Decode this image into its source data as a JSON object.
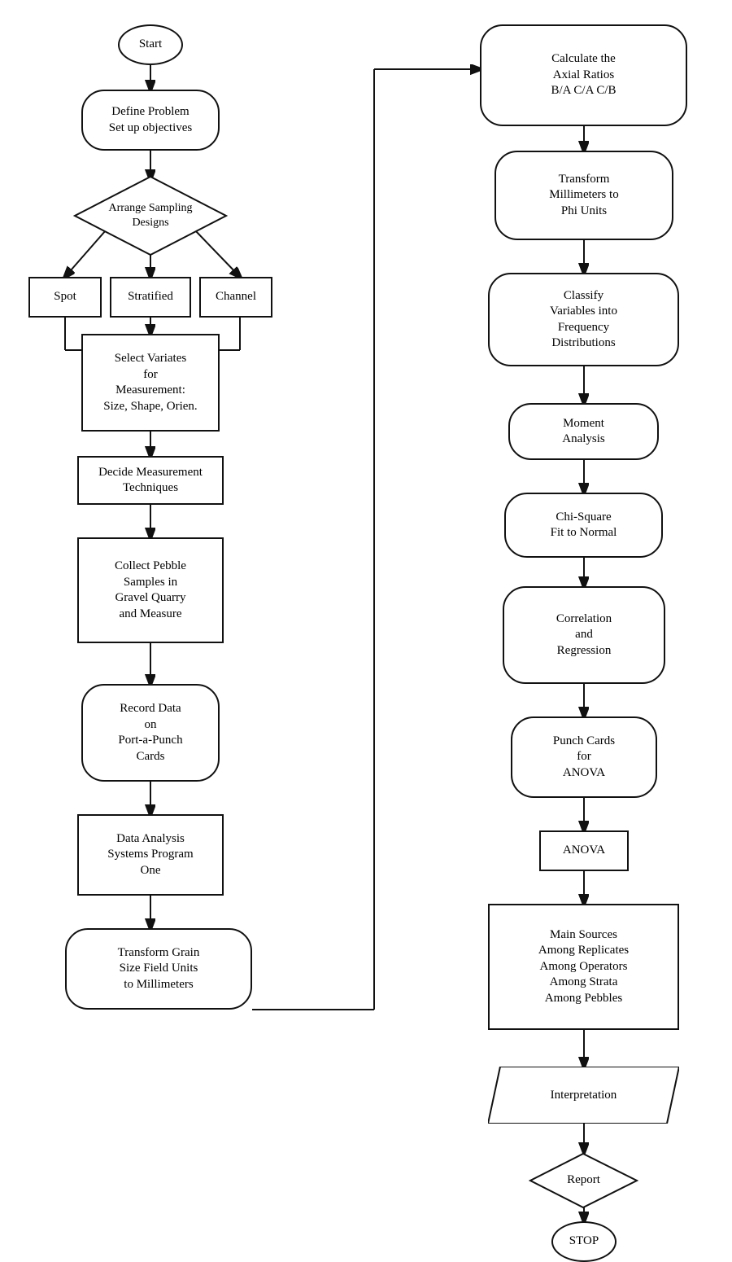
{
  "nodes": {
    "start": "Start",
    "define_problem": "Define Problem\nSet up objectives",
    "arrange_sampling": "Arrange Sampling\nDesigns",
    "spot": "Spot",
    "stratified": "Stratified",
    "channel": "Channel",
    "select_variates": "Select Variates\nfor\nMeasurement:\nSize, Shape, Orien.",
    "decide_measurement": "Decide Measurement\nTechniques",
    "collect_pebble": "Collect Pebble\nSamples in\nGravel Quarry\nand Measure",
    "record_data": "Record Data\non\nPort-a-Punch\nCards",
    "data_analysis": "Data Analysis\nSystems Program\nOne",
    "transform_grain": "Transform Grain\nSize Field Units\nto Millimeters",
    "calculate_axial": "Calculate the\nAxial Ratios\nB/A  C/A  C/B",
    "transform_mm": "Transform\nMillimeters to\nPhi Units",
    "classify_variables": "Classify\nVariables into\nFrequency\nDistributions",
    "moment_analysis": "Moment\nAnalysis",
    "chi_square": "Chi-Square\nFit to Normal",
    "correlation": "Correlation\nand\nRegression",
    "punch_cards": "Punch Cards\nfor\nANOVA",
    "anova": "ANOVA",
    "main_sources": "Main Sources\nAmong Replicates\nAmong Operators\nAmong Strata\nAmong Pebbles",
    "interpretation": "Interpretation",
    "report": "Report",
    "stop": "STOP"
  }
}
